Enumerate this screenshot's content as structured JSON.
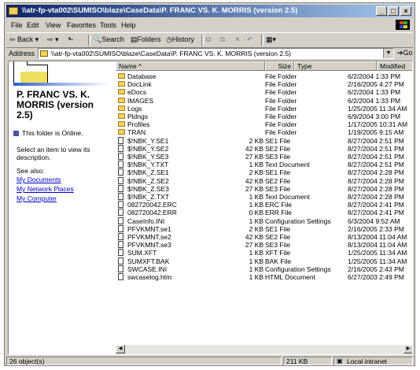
{
  "window": {
    "title": "\\\\atr-fp-vta002\\SUMISO\\blaze\\CaseData\\P. FRANC VS. K. MORRIS (version 2.5)"
  },
  "menu": [
    "File",
    "Edit",
    "View",
    "Favorites",
    "Tools",
    "Help"
  ],
  "toolbar": {
    "back": "Back",
    "search": "Search",
    "folders": "Folders",
    "history": "History"
  },
  "address": {
    "label": "Address",
    "value": "\\\\atr-fp-vta002\\SUMISO\\blaze\\CaseData\\P. FRANC VS. K. MORRIS (version 2.5)",
    "go": "Go"
  },
  "left_pane": {
    "folder_title": "P. FRANC VS. K. MORRIS (version 2.5)",
    "online_text": "This folder is Online.",
    "select_text": "Select an item to view its description.",
    "see_also": "See also:",
    "links": [
      "My Documents",
      "My Network Places",
      "My Computer"
    ]
  },
  "columns": [
    "Name",
    "Size",
    "Type",
    "Modified"
  ],
  "files": [
    {
      "name": "Database",
      "size": "",
      "type": "File Folder",
      "modified": "6/2/2004 1:33 PM",
      "kind": "folder"
    },
    {
      "name": "DocLink",
      "size": "",
      "type": "File Folder",
      "modified": "2/16/2005 4:27 PM",
      "kind": "folder"
    },
    {
      "name": "eDocs",
      "size": "",
      "type": "File Folder",
      "modified": "6/2/2004 1:33 PM",
      "kind": "folder"
    },
    {
      "name": "IMAGES",
      "size": "",
      "type": "File Folder",
      "modified": "6/2/2004 1:33 PM",
      "kind": "folder"
    },
    {
      "name": "Logs",
      "size": "",
      "type": "File Folder",
      "modified": "1/25/2005 11:34 AM",
      "kind": "folder"
    },
    {
      "name": "Pldngs",
      "size": "",
      "type": "File Folder",
      "modified": "6/9/2004 3:00 PM",
      "kind": "folder"
    },
    {
      "name": "Profiles",
      "size": "",
      "type": "File Folder",
      "modified": "1/17/2005 10:31 AM",
      "kind": "folder"
    },
    {
      "name": "TRAN",
      "size": "",
      "type": "File Folder",
      "modified": "1/19/2005 9:15 AM",
      "kind": "folder"
    },
    {
      "name": "$!NBK_Y.SE1",
      "size": "2 KB",
      "type": "SE1 File",
      "modified": "8/27/2004 2:51 PM",
      "kind": "file"
    },
    {
      "name": "$!NBK_Y.SE2",
      "size": "42 KB",
      "type": "SE2 File",
      "modified": "8/27/2004 2:51 PM",
      "kind": "file"
    },
    {
      "name": "$!NBK_Y.SE3",
      "size": "27 KB",
      "type": "SE3 File",
      "modified": "8/27/2004 2:51 PM",
      "kind": "file"
    },
    {
      "name": "$!NBK_Y.TXT",
      "size": "1 KB",
      "type": "Text Document",
      "modified": "8/27/2004 2:51 PM",
      "kind": "doc"
    },
    {
      "name": "$!NBK_Z.SE1",
      "size": "2 KB",
      "type": "SE1 File",
      "modified": "8/27/2004 2:28 PM",
      "kind": "file"
    },
    {
      "name": "$!NBK_Z.SE2",
      "size": "42 KB",
      "type": "SE2 File",
      "modified": "8/27/2004 2:28 PM",
      "kind": "file"
    },
    {
      "name": "$!NBK_Z.SE3",
      "size": "27 KB",
      "type": "SE3 File",
      "modified": "8/27/2004 2:28 PM",
      "kind": "file"
    },
    {
      "name": "$!NBK_Z.TXT",
      "size": "1 KB",
      "type": "Text Document",
      "modified": "8/27/2004 2:28 PM",
      "kind": "doc"
    },
    {
      "name": "082720042.ERC",
      "size": "1 KB",
      "type": "ERC File",
      "modified": "8/27/2004 2:41 PM",
      "kind": "file"
    },
    {
      "name": "082720042.ERR",
      "size": "0 KB",
      "type": "ERR File",
      "modified": "8/27/2004 2:41 PM",
      "kind": "file"
    },
    {
      "name": "CaseInfo.INI",
      "size": "1 KB",
      "type": "Configuration Settings",
      "modified": "6/3/2004 9:52 AM",
      "kind": "doc"
    },
    {
      "name": "PFVKMNT.se1",
      "size": "2 KB",
      "type": "SE1 File",
      "modified": "2/16/2005 2:33 PM",
      "kind": "file"
    },
    {
      "name": "PFVKMNT.se2",
      "size": "42 KB",
      "type": "SE2 File",
      "modified": "8/13/2004 11:04 AM",
      "kind": "file"
    },
    {
      "name": "PFVKMNT.se3",
      "size": "27 KB",
      "type": "SE3 File",
      "modified": "8/13/2004 11:04 AM",
      "kind": "file"
    },
    {
      "name": "SUM.XFT",
      "size": "1 KB",
      "type": "XFT File",
      "modified": "1/25/2005 11:34 AM",
      "kind": "file"
    },
    {
      "name": "SUMXFT.BAK",
      "size": "1 KB",
      "type": "BAK File",
      "modified": "1/25/2005 11:34 AM",
      "kind": "file"
    },
    {
      "name": "SWCASE.INI",
      "size": "1 KB",
      "type": "Configuration Settings",
      "modified": "2/16/2005 2:43 PM",
      "kind": "doc"
    },
    {
      "name": "swcaselog.htm",
      "size": "1 KB",
      "type": "HTML Document",
      "modified": "6/27/2003 2:49 PM",
      "kind": "doc"
    }
  ],
  "status": {
    "objects": "26 object(s)",
    "size": "211 KB",
    "zone": "Local intranet"
  }
}
